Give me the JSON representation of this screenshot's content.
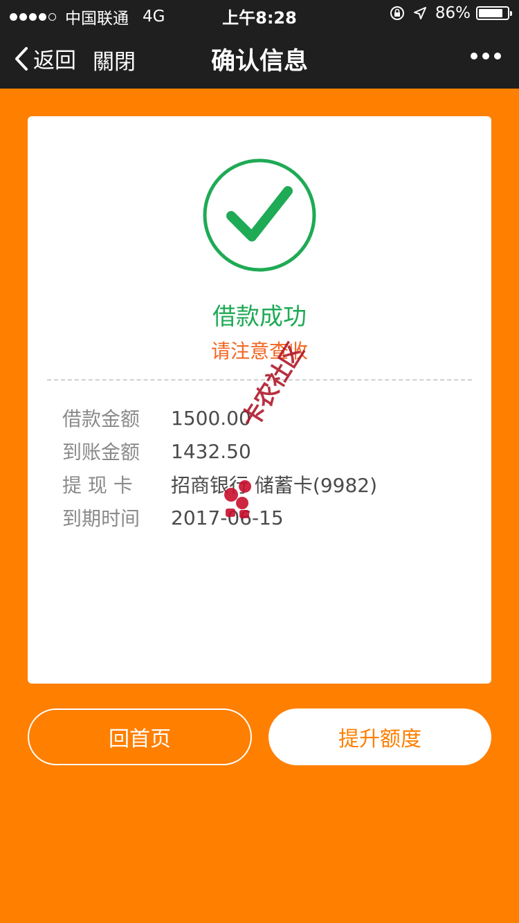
{
  "status_bar": {
    "carrier": "中国联通",
    "network": "4G",
    "time": "上午8:28",
    "battery": "86%",
    "battery_level": 0.86
  },
  "nav": {
    "back_label": "返回",
    "close_label": "關閉",
    "title": "确认信息"
  },
  "result": {
    "title": "借款成功",
    "subtitle": "请注意查收"
  },
  "details": [
    {
      "label": "借款金额",
      "value": "1500.00"
    },
    {
      "label": "到账金额",
      "value": "1432.50"
    },
    {
      "label": "提 现 卡",
      "value": "招商银行 储蓄卡(9982)"
    },
    {
      "label": "到期时间",
      "value": "2017-06-15"
    }
  ],
  "watermark": "卡农社区",
  "buttons": {
    "home": "回首页",
    "upgrade": "提升额度"
  },
  "colors": {
    "accent": "#ff7f00",
    "success": "#1faa55",
    "notice": "#f26522",
    "topbar": "#1f1f1f"
  }
}
